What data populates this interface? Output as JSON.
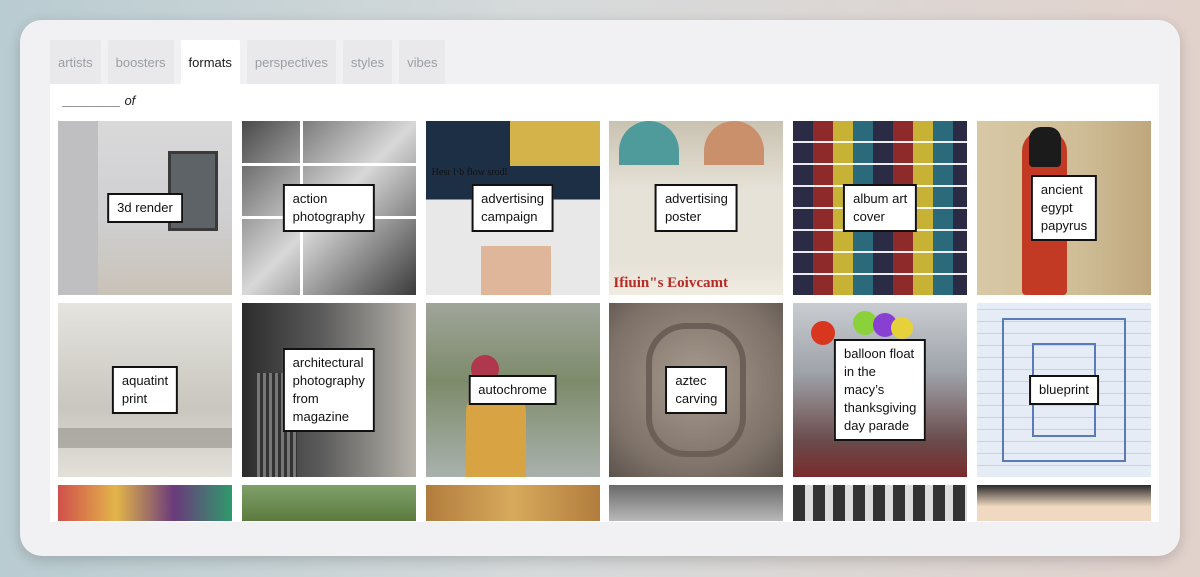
{
  "tabs": [
    {
      "label": "artists",
      "active": false
    },
    {
      "label": "boosters",
      "active": false
    },
    {
      "label": "formats",
      "active": true
    },
    {
      "label": "perspectives",
      "active": false
    },
    {
      "label": "styles",
      "active": false
    },
    {
      "label": "vibes",
      "active": false
    }
  ],
  "prompt": "________ of",
  "tiles": [
    {
      "label": "3d render"
    },
    {
      "label": "action\nphotography"
    },
    {
      "label": "advertising\ncampaign"
    },
    {
      "label": "advertising\nposter"
    },
    {
      "label": "album art\ncover"
    },
    {
      "label": "ancient\negypt\npapyrus"
    },
    {
      "label": "aquatint\nprint"
    },
    {
      "label": "architectural\nphotography\nfrom\nmagazine"
    },
    {
      "label": "autochrome"
    },
    {
      "label": "aztec\ncarving"
    },
    {
      "label": "balloon float\nin the\nmacy’s\nthanksgiving\nday parade"
    },
    {
      "label": "blueprint"
    }
  ],
  "poster_texts": {
    "adcamp_headline": "Hesr l·b flow srodl",
    "adposter_headline": "Ifiuin\"s Eoivcamt"
  },
  "colors": {
    "card_bg": "#f1f1f3",
    "active_tab": "#ffffff",
    "inactive_tab_text": "#9a9ea4"
  }
}
